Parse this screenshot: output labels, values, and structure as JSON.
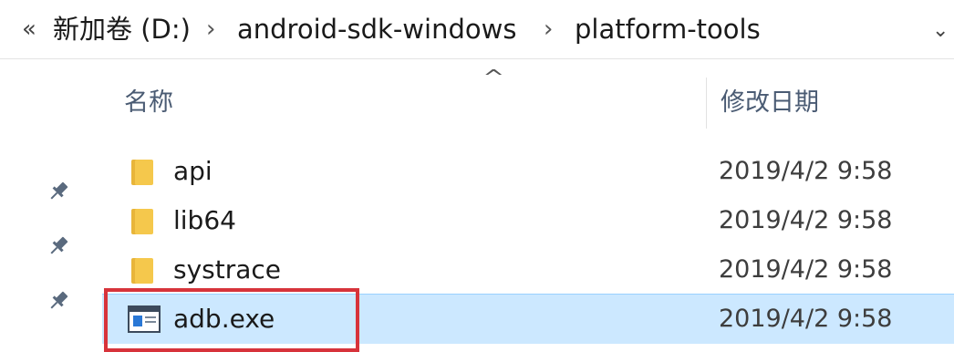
{
  "address": {
    "overflow_glyph": "«",
    "crumbs": [
      "新加卷 (D:)",
      "android-sdk-windows",
      "platform-tools"
    ],
    "separator": "›",
    "dropdown_glyph": "⌄"
  },
  "header": {
    "sort_indicator": "^",
    "col_name": "名称",
    "col_date": "修改日期"
  },
  "files": [
    {
      "name": "api",
      "type": "folder",
      "modified": "2019/4/2 9:58"
    },
    {
      "name": "lib64",
      "type": "folder",
      "modified": "2019/4/2 9:58"
    },
    {
      "name": "systrace",
      "type": "folder",
      "modified": "2019/4/2 9:58"
    },
    {
      "name": "adb.exe",
      "type": "exe",
      "modified": "2019/4/2 9:58",
      "selected": true
    }
  ],
  "colors": {
    "folder": "#f5c84c",
    "selection": "#cce8ff",
    "highlight": "#d7333b"
  }
}
